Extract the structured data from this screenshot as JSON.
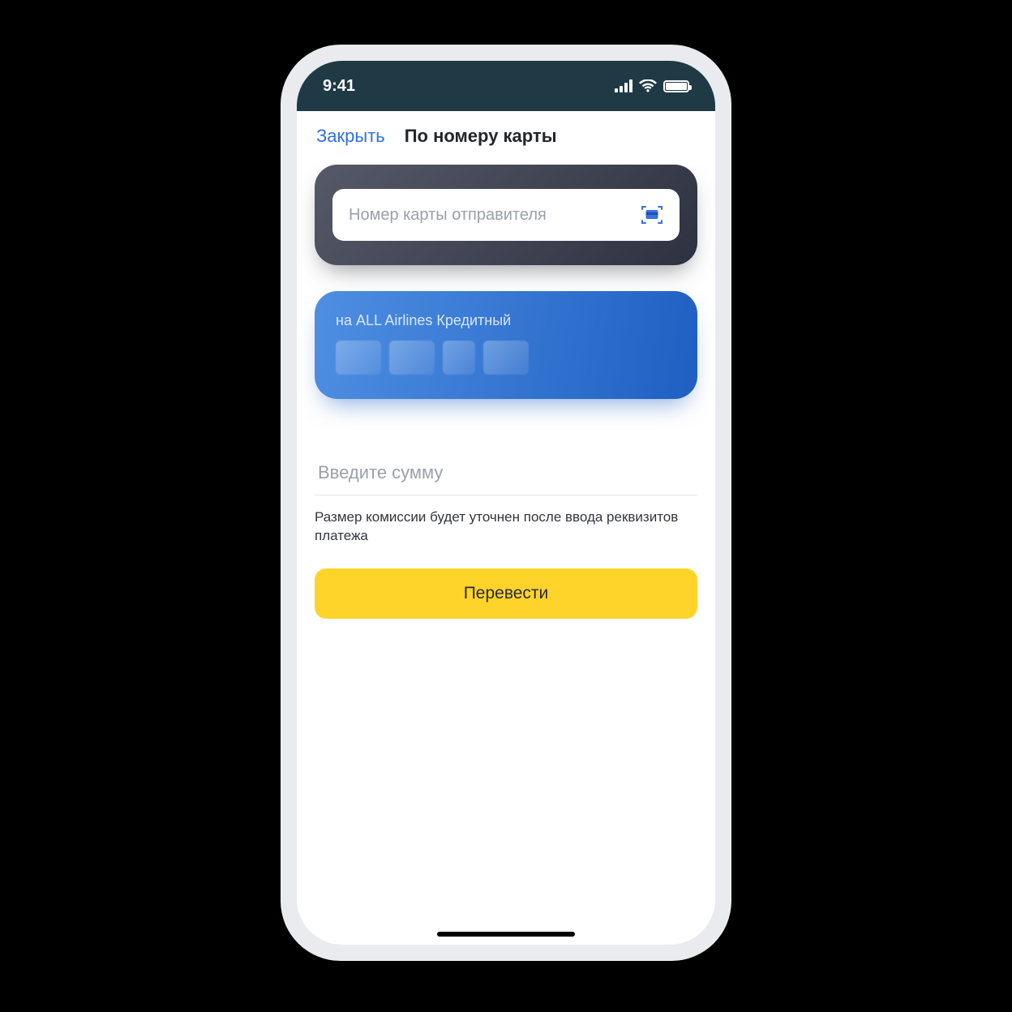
{
  "status": {
    "time": "9:41"
  },
  "nav": {
    "close_label": "Закрыть",
    "title": "По номеру карты"
  },
  "sender": {
    "placeholder": "Номер карты отправителя",
    "value": ""
  },
  "destination": {
    "label": "на ALL Airlines Кредитный"
  },
  "amount": {
    "placeholder": "Введите сумму",
    "value": ""
  },
  "hint": "Размер комиссии будет уточнен после ввода реквизитов платежа",
  "submit_label": "Перевести",
  "colors": {
    "accent_link": "#2f6fe4",
    "submit_bg": "#ffd42a",
    "status_bg": "#1f3a45"
  }
}
